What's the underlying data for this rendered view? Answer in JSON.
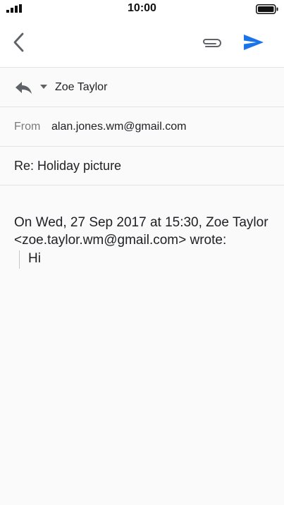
{
  "status_bar": {
    "time": "10:00"
  },
  "toolbar": {
    "back_icon": "chevron-left-icon",
    "attach_icon": "paperclip-icon",
    "send_icon": "send-icon",
    "send_color": "#1a73e8"
  },
  "compose": {
    "reply_icon": "reply-icon",
    "reply_to": "Zoe Taylor",
    "from_label": "From",
    "from_value": "alan.jones.wm@gmail.com",
    "subject": "Re: Holiday picture",
    "quote_header": "On Wed, 27 Sep 2017 at 15:30, Zoe Taylor <zoe.taylor.wm@gmail.com> wrote:",
    "quote_text": "Hi"
  }
}
